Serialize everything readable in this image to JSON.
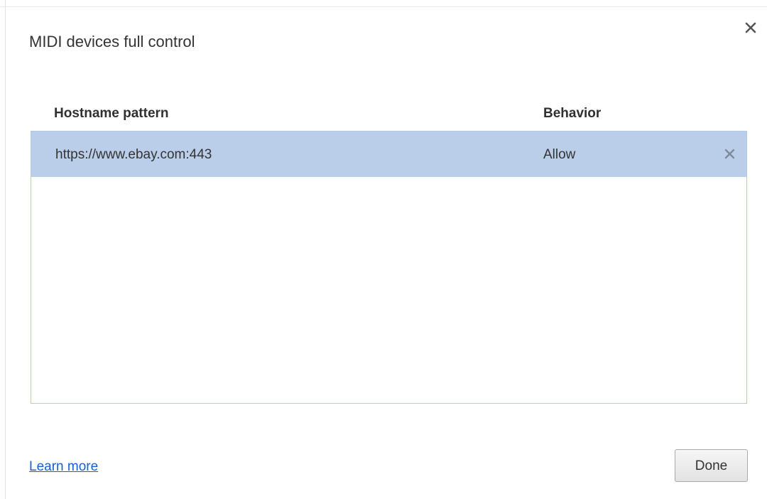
{
  "dialog": {
    "title": "MIDI devices full control"
  },
  "table": {
    "headers": {
      "hostname": "Hostname pattern",
      "behavior": "Behavior"
    },
    "rows": [
      {
        "hostname": "https://www.ebay.com:443",
        "behavior": "Allow",
        "selected": true
      }
    ]
  },
  "footer": {
    "learn_more": "Learn more",
    "done_label": "Done"
  },
  "icons": {
    "close": "close-icon",
    "remove": "remove-icon"
  },
  "colors": {
    "selected_row": "#bbcee9",
    "list_border": "#b4c9e6",
    "link": "#1a5fd6"
  }
}
